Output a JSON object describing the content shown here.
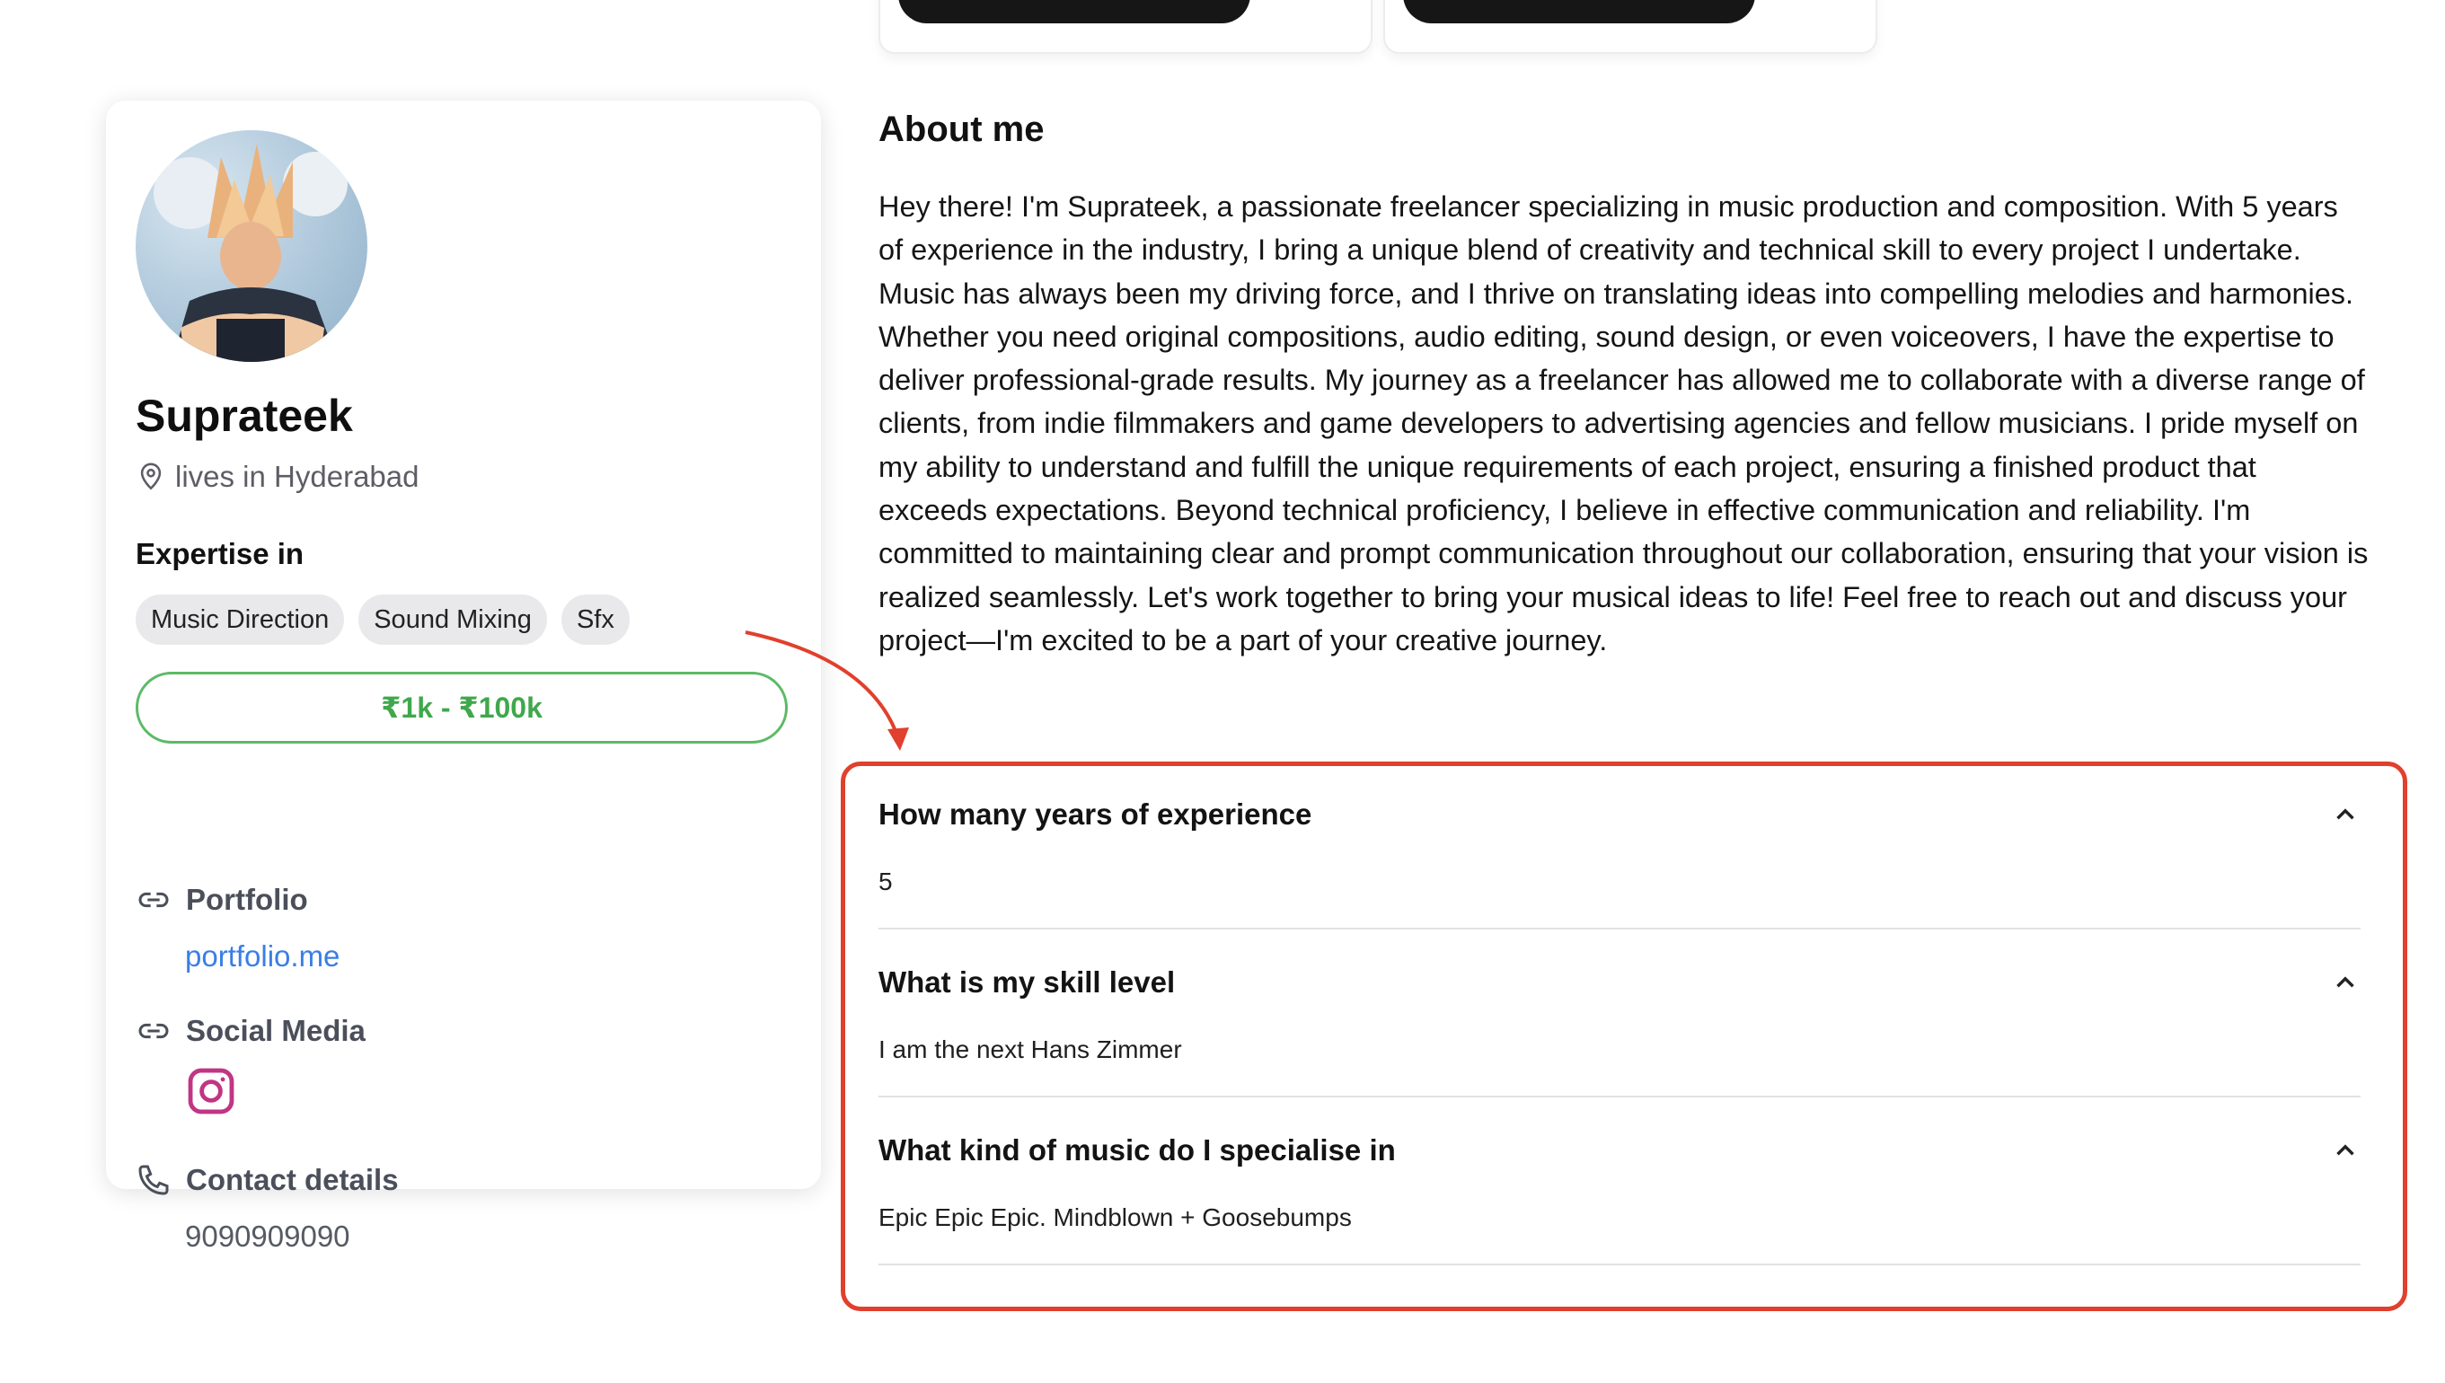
{
  "profile": {
    "name": "Suprateek",
    "location": "lives in Hyderabad",
    "expertise_title": "Expertise in",
    "tags": [
      "Music Direction",
      "Sound Mixing",
      "Sfx"
    ],
    "price_range": "₹1k - ₹100k",
    "portfolio_label": "Portfolio",
    "portfolio_link": "portfolio.me",
    "social_label": "Social Media",
    "contact_label": "Contact details",
    "phone": "9090909090"
  },
  "about": {
    "title": "About me",
    "text": "Hey there! I'm Suprateek, a passionate freelancer specializing in music production and composition. With 5 years of experience in the industry, I bring a unique blend of creativity and technical skill to every project I undertake. Music has always been my driving force, and I thrive on translating ideas into compelling melodies and harmonies. Whether you need original compositions, audio editing, sound design, or even voiceovers, I have the expertise to deliver professional-grade results. My journey as a freelancer has allowed me to collaborate with a diverse range of clients, from indie filmmakers and game developers to advertising agencies and fellow musicians. I pride myself on my ability to understand and fulfill the unique requirements of each project, ensuring a finished product that exceeds expectations. Beyond technical proficiency, I believe in effective communication and reliability. I'm committed to maintaining clear and prompt communication throughout our collaboration, ensuring that your vision is realized seamlessly. Let's work together to bring your musical ideas to life! Feel free to reach out and discuss your project—I'm excited to be a part of your creative journey."
  },
  "faq": [
    {
      "question": "How many years of experience",
      "answer": "5"
    },
    {
      "question": "What is my skill level",
      "answer": "I am the next Hans Zimmer"
    },
    {
      "question": "What kind of music do I specialise in",
      "answer": "Epic Epic Epic. Mindblown + Goosebumps"
    }
  ],
  "colors": {
    "price_green": "#3fa84c",
    "link_blue": "#3a7ee6",
    "highlight_red": "#e0402d",
    "instagram": "#c13584"
  },
  "icons": [
    "location-pin-icon",
    "link-icon",
    "instagram-icon",
    "phone-icon",
    "chevron-up-icon"
  ]
}
